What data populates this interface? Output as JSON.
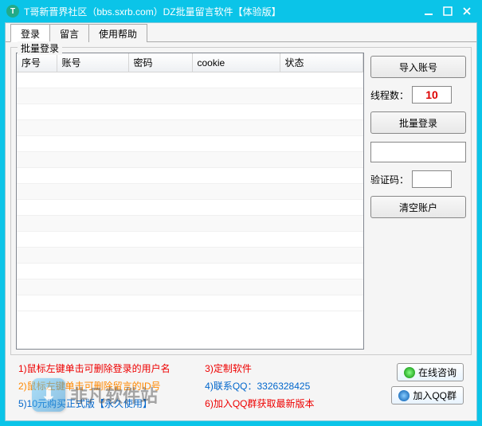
{
  "window": {
    "title": "T哥新晋界社区（bbs.sxrb.com）DZ批量留言软件【体验版】"
  },
  "tabs": {
    "login": "登录",
    "message": "留言",
    "help": "使用帮助"
  },
  "group": {
    "title": "批量登录"
  },
  "columns": {
    "seq": "序号",
    "account": "账号",
    "password": "密码",
    "cookie": "cookie",
    "status": "状态"
  },
  "side": {
    "import": "导入账号",
    "threads_label": "线程数：",
    "threads_value": "10",
    "batch_login": "批量登录",
    "captcha_label": "验证码：",
    "captcha_value": "",
    "clear": "清空账户"
  },
  "footer": {
    "l1": "1)鼠标左键单击可删除登录的用户名",
    "l2": "2)鼠标左键单击可删除留言的ID号",
    "l3": "5)10元购买正式版【永久使用】",
    "r1": "3)定制软件",
    "r2": "4)联系QQ：3326328425",
    "r3": "6)加入QQ群获取最新版本",
    "btn_online": "在线咨询",
    "btn_qq": "加入QQ群"
  },
  "watermark": {
    "text": "非凡软件站"
  }
}
